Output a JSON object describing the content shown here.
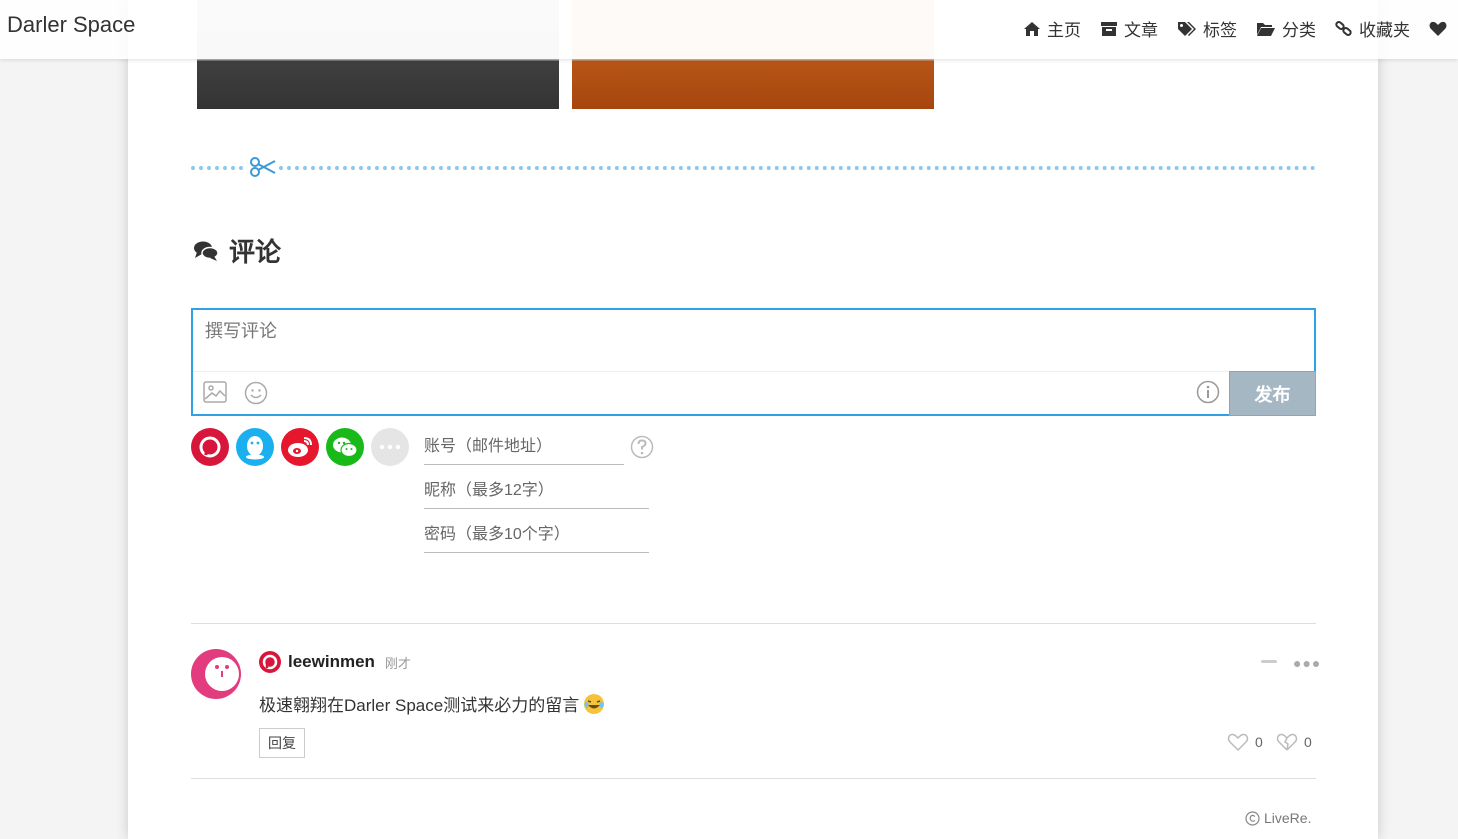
{
  "header": {
    "brand": "Darler Space",
    "nav": [
      {
        "label": "主页",
        "icon": "home-icon"
      },
      {
        "label": "文章",
        "icon": "archive-icon"
      },
      {
        "label": "标签",
        "icon": "tags-icon"
      },
      {
        "label": "分类",
        "icon": "folder-open-icon"
      },
      {
        "label": "收藏夹",
        "icon": "link-icon"
      },
      {
        "label": "",
        "icon": "heart-icon"
      }
    ]
  },
  "comments": {
    "heading": "评论",
    "editor": {
      "placeholder": "撰写评论",
      "publish_label": "发布",
      "tools": [
        "image-icon",
        "emoji-icon",
        "info-icon"
      ]
    },
    "login": {
      "providers": [
        "livere-icon",
        "qq-icon",
        "weibo-icon",
        "wechat-icon",
        "more-icon"
      ],
      "account_placeholder": "账号（邮件地址）",
      "nickname_placeholder": "昵称（最多12字）",
      "password_placeholder": "密码（最多10个字）"
    },
    "items": [
      {
        "author": "leewinmen",
        "time": "刚才",
        "text": "极速翱翔在Darler Space测试来必力的留言",
        "reply_label": "回复",
        "likes": "0",
        "dislikes": "0"
      }
    ],
    "powered_by": "LiveRe."
  },
  "colors": {
    "accent": "#2fa2e4",
    "publish_bg": "#a6b7c4",
    "divider": "#8cc8ee",
    "livere_red": "#d8163c",
    "qq_blue": "#1ab0f0",
    "weibo_red": "#e6162d",
    "wechat_green": "#1ab91a"
  }
}
